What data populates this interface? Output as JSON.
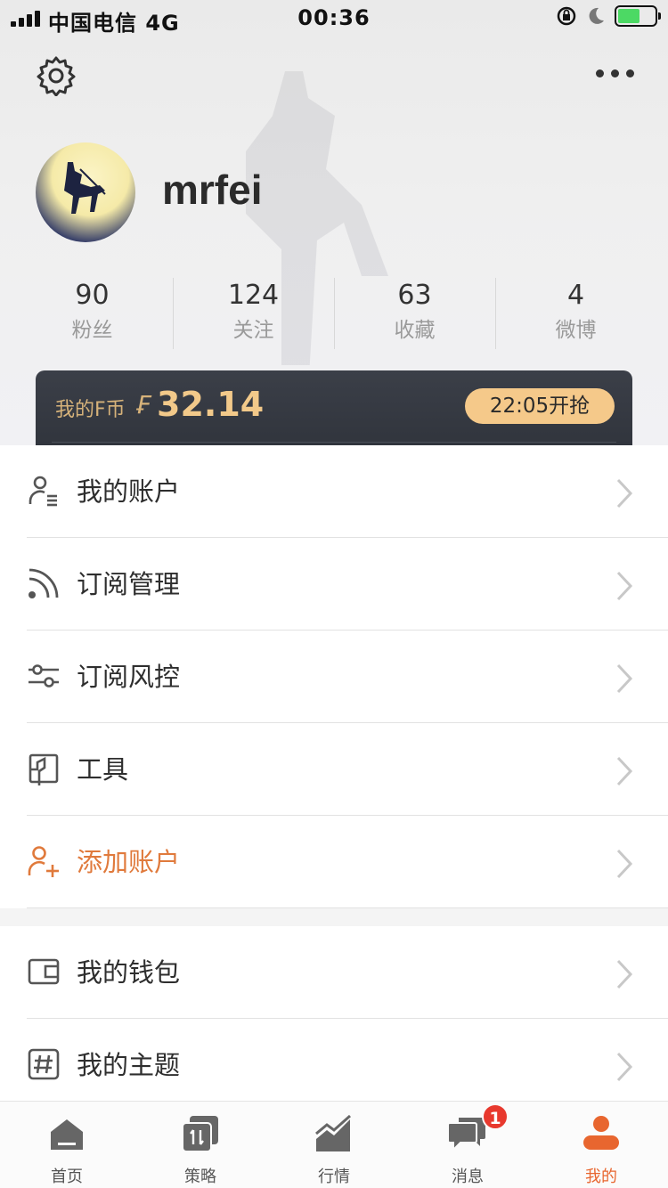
{
  "status_bar": {
    "carrier": "中国电信 4G",
    "time": "00:36"
  },
  "header": {
    "settings_icon": "gear-icon",
    "more_icon": "more-dots-icon"
  },
  "profile": {
    "username": "mrfei",
    "stats": [
      {
        "value": "90",
        "label": "粉丝"
      },
      {
        "value": "124",
        "label": "关注"
      },
      {
        "value": "63",
        "label": "收藏"
      },
      {
        "value": "4",
        "label": "微博"
      }
    ]
  },
  "fcoin": {
    "label": "我的F币",
    "symbol": "₣",
    "value": "32.14",
    "grab_button": "22:05开抢"
  },
  "menu_primary": [
    {
      "label": "我的账户",
      "icon": "user-list-icon"
    },
    {
      "label": "订阅管理",
      "icon": "rss-icon"
    },
    {
      "label": "订阅风控",
      "icon": "sliders-icon"
    },
    {
      "label": "工具",
      "icon": "tool-icon"
    },
    {
      "label": "添加账户",
      "icon": "add-user-icon",
      "accent": "#e07a3c"
    }
  ],
  "menu_secondary": [
    {
      "label": "我的钱包",
      "icon": "wallet-icon"
    },
    {
      "label": "我的主题",
      "icon": "hashtag-icon"
    }
  ],
  "tabbar": {
    "tabs": [
      {
        "label": "首页",
        "icon": "home-icon"
      },
      {
        "label": "策略",
        "icon": "strategy-icon"
      },
      {
        "label": "行情",
        "icon": "chart-icon"
      },
      {
        "label": "消息",
        "icon": "message-icon",
        "badge": "1"
      },
      {
        "label": "我的",
        "icon": "profile-icon",
        "active": true
      }
    ]
  },
  "colors": {
    "accent": "#e8662f",
    "fcoin_gold": "#f2c98a",
    "badge_red": "#e8392e"
  }
}
